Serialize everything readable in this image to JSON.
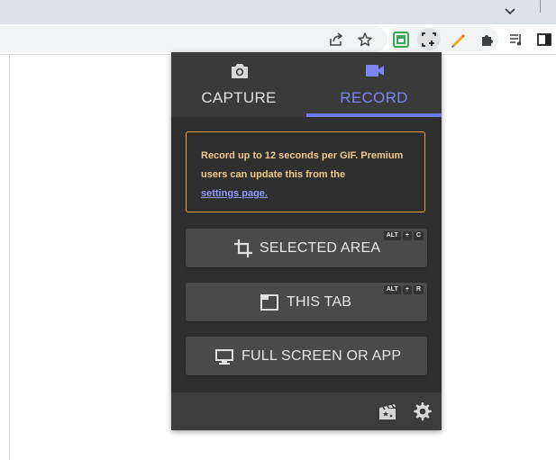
{
  "browser": {
    "icons": [
      "chevron-down-icon",
      "share-icon",
      "star-icon",
      "gif-recorder-extension-icon",
      "screenshot-extension-icon",
      "pencil-extension-icon",
      "puzzle-icon",
      "media-queue-icon",
      "side-panel-icon"
    ]
  },
  "popup": {
    "tabs": [
      {
        "label": "CAPTURE",
        "icon": "camera-icon",
        "active": false
      },
      {
        "label": "RECORD",
        "icon": "video-camera-icon",
        "active": true
      }
    ],
    "notice": {
      "text": "Record up to 12 seconds per GIF. Premium users can update this from the",
      "link": "settings page."
    },
    "buttons": [
      {
        "label": "SELECTED AREA",
        "icon": "crop-icon",
        "hotkey": [
          "ALT",
          "+",
          "C"
        ]
      },
      {
        "label": "THIS TAB",
        "icon": "browser-tab-icon",
        "hotkey": [
          "ALT",
          "+",
          "R"
        ]
      },
      {
        "label": "FULL SCREEN OR APP",
        "icon": "monitor-icon",
        "hotkey": []
      }
    ],
    "footer": {
      "icons": [
        "clapperboard-icon",
        "settings-gear-icon"
      ]
    },
    "colors": {
      "accent": "#6b78ee",
      "notice_border": "#e3a33a",
      "notice_text": "#f2c98a",
      "link": "#8c9cff",
      "background": "#2f2f2f"
    }
  }
}
